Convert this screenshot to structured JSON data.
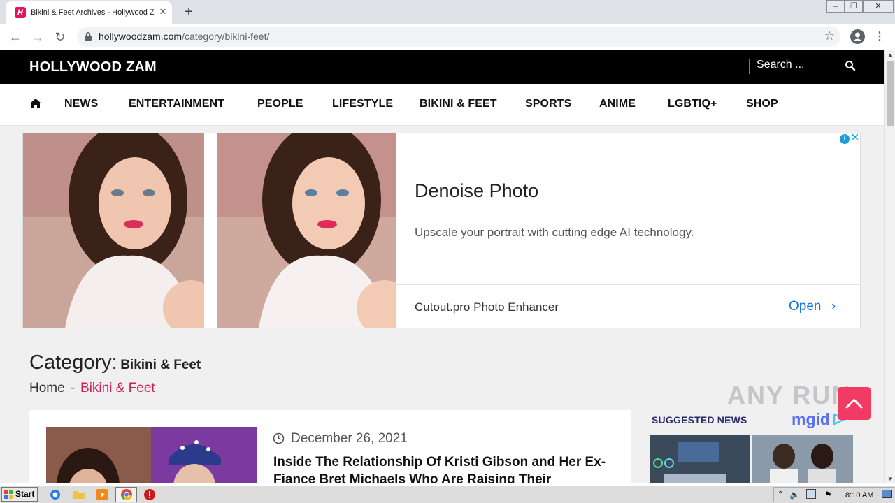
{
  "browser": {
    "tab_title": "Bikini & Feet Archives - Hollywood Zam",
    "favicon_letter": "H",
    "url_host": "hollywoodzam.com",
    "url_path": "/category/bikini-feet/",
    "icons": [
      "back-icon",
      "forward-icon",
      "reload-icon",
      "lock-icon",
      "star-icon",
      "profile-icon",
      "menu-icon",
      "minimize-icon",
      "restore-icon",
      "close-icon"
    ]
  },
  "site": {
    "logo": "HOLLYWOOD ZAM",
    "search_placeholder": "Search ...",
    "nav": [
      "NEWS",
      "ENTERTAINMENT",
      "PEOPLE",
      "LIFESTYLE",
      "BIKINI & FEET",
      "SPORTS",
      "ANIME",
      "LGBTIQ+",
      "SHOP"
    ]
  },
  "ad": {
    "headline": "Denoise Photo",
    "description": "Upscale your portrait with cutting edge AI technology.",
    "advertiser": "Cutout.pro Photo Enhancer",
    "cta": "Open"
  },
  "category": {
    "prefix": "Category:",
    "name": "Bikini & Feet",
    "breadcrumb_home": "Home",
    "breadcrumb_sep": "-",
    "breadcrumb_current": "Bikini & Feet"
  },
  "article": {
    "date": "December 26, 2021",
    "title": "Inside The Relationship Of Kristi Gibson and Her Ex-Fiance Bret Michaels Who Are Raising Their Daughters"
  },
  "sidebar": {
    "title": "SUGGESTED NEWS",
    "brand": "mgid"
  },
  "watermark": "ANY RUN",
  "taskbar": {
    "start": "Start",
    "clock": "8:10 AM"
  },
  "colors": {
    "accent": "#d11e5a",
    "header_bg": "#000000",
    "cta_blue": "#1a73e8",
    "back_to_top": "#f13a64"
  }
}
